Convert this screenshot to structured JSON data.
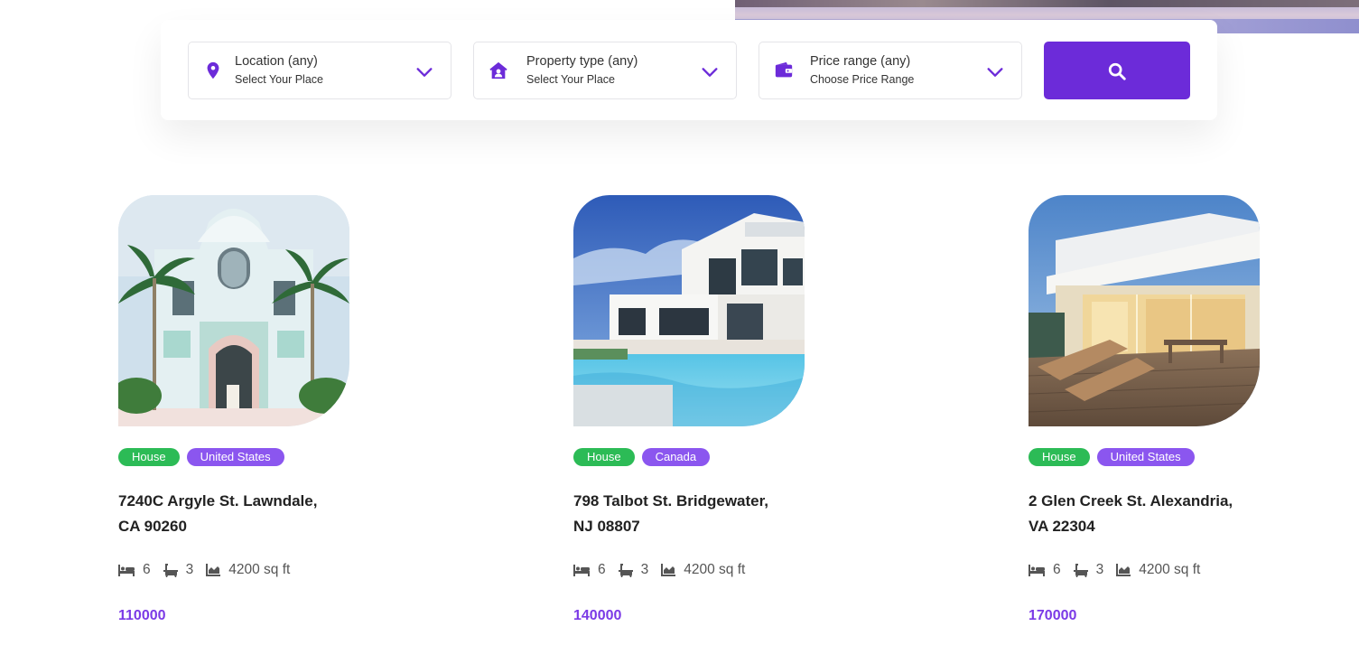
{
  "search": {
    "location": {
      "title": "Location (any)",
      "subtitle": "Select Your Place",
      "icon": "map-pin-icon"
    },
    "property_type": {
      "title": "Property type (any)",
      "subtitle": "Select Your Place",
      "icon": "home-user-icon"
    },
    "price_range": {
      "title": "Price range (any)",
      "subtitle": "Choose Price Range",
      "icon": "wallet-icon"
    },
    "button_icon": "search-icon"
  },
  "colors": {
    "accent": "#6c2bd9",
    "price": "#7b3ae6",
    "type_badge": "#2cbb56",
    "country_badge": "#8b56ef"
  },
  "listings": [
    {
      "type": "House",
      "country": "United States",
      "address_line1": "7240C Argyle St. Lawndale,",
      "address_line2": "CA 90260",
      "beds": "6",
      "baths": "3",
      "area": "4200 sq ft",
      "price": "110000"
    },
    {
      "type": "House",
      "country": "Canada",
      "address_line1": "798 Talbot St. Bridgewater,",
      "address_line2": "NJ 08807",
      "beds": "6",
      "baths": "3",
      "area": "4200 sq ft",
      "price": "140000"
    },
    {
      "type": "House",
      "country": "United States",
      "address_line1": "2 Glen Creek St. Alexandria,",
      "address_line2": "VA 22304",
      "beds": "6",
      "baths": "3",
      "area": "4200 sq ft",
      "price": "170000"
    }
  ]
}
